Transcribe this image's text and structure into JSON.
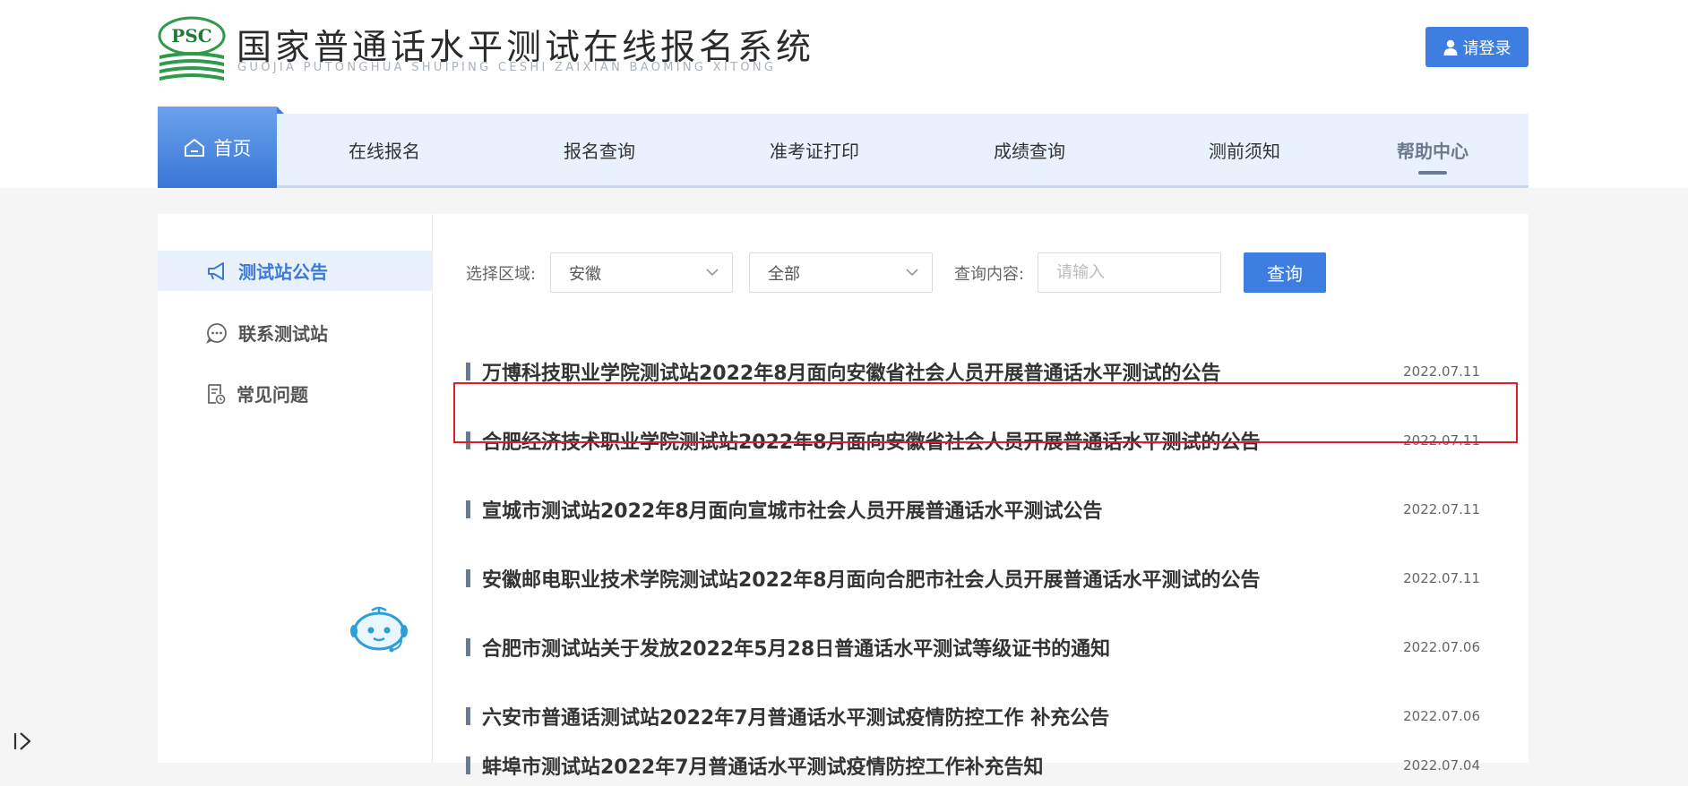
{
  "header": {
    "logo_text": "PSC",
    "site_title": "国家普通话水平测试在线报名系统",
    "site_subtitle": "GUOJIA PUTONGHUA SHUIPING CESHI ZAIXIAN BAOMING XITONG",
    "login_label": "请登录"
  },
  "nav": {
    "items": [
      {
        "label": "首页"
      },
      {
        "label": "在线报名"
      },
      {
        "label": "报名查询"
      },
      {
        "label": "准考证打印"
      },
      {
        "label": "成绩查询"
      },
      {
        "label": "测前须知"
      },
      {
        "label": "帮助中心"
      }
    ]
  },
  "sidebar": {
    "items": [
      {
        "label": "测试站公告"
      },
      {
        "label": "联系测试站"
      },
      {
        "label": "常见问题"
      }
    ]
  },
  "filter": {
    "region_label": "选择区域:",
    "region_value": "安徽",
    "scope_value": "全部",
    "query_label": "查询内容:",
    "query_placeholder": "请输入",
    "search_label": "查询"
  },
  "notices": [
    {
      "title": "万博科技职业学院测试站2022年8月面向安徽省社会人员开展普通话水平测试的公告",
      "date": "2022.07.11"
    },
    {
      "title": "合肥经济技术职业学院测试站2022年8月面向安徽省社会人员开展普通话水平测试的公告",
      "date": "2022.07.11"
    },
    {
      "title": "宣城市测试站2022年8月面向宣城市社会人员开展普通话水平测试公告",
      "date": "2022.07.11"
    },
    {
      "title": "安徽邮电职业技术学院测试站2022年8月面向合肥市社会人员开展普通话水平测试的公告",
      "date": "2022.07.11"
    },
    {
      "title": "合肥市测试站关于发放2022年5月28日普通话水平测试等级证书的通知",
      "date": "2022.07.06"
    },
    {
      "title": "六安市普通话测试站2022年7月普通话水平测试疫情防控工作 补充公告",
      "date": "2022.07.06"
    },
    {
      "title": "蚌埠市测试站2022年7月普通话水平测试疫情防控工作补充告知",
      "date": "2022.07.04"
    }
  ],
  "colors": {
    "primary": "#3d7ee0",
    "highlight_border": "#e11c24",
    "nav_bg": "#e8f1fc"
  }
}
